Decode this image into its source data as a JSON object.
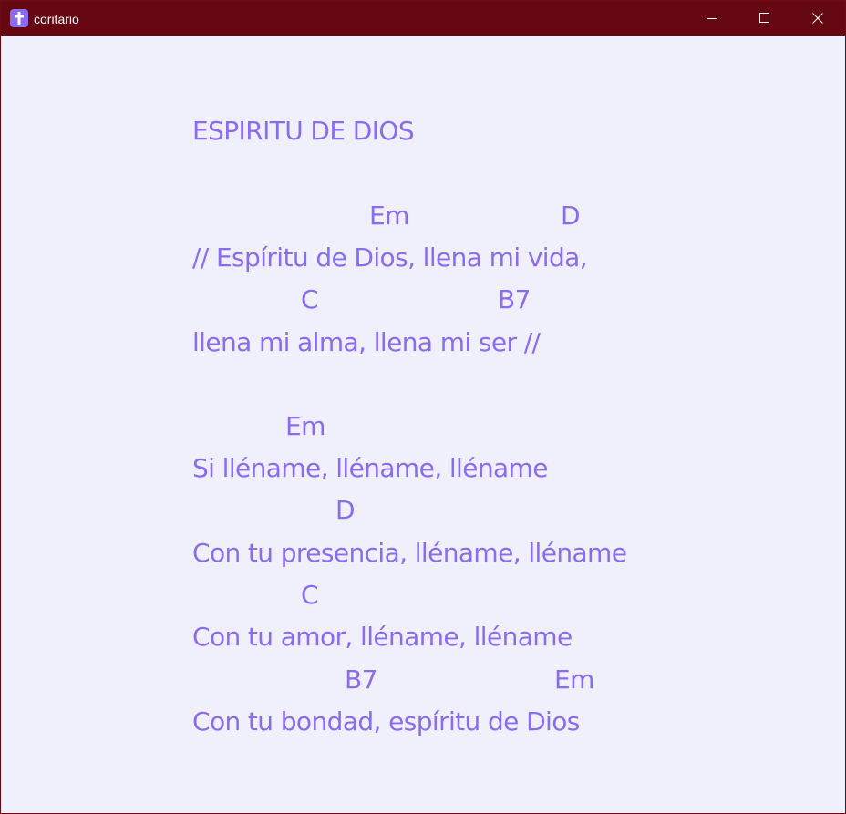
{
  "window": {
    "title": "coritario",
    "icon": "cross-icon",
    "controls": [
      "minimize-icon",
      "maximize-icon",
      "close-icon"
    ],
    "titlebar_color": "#660812"
  },
  "song": {
    "text_color": "#8a6cf0",
    "title": "ESPIRITU DE DIOS",
    "lines": [
      {
        "type": "chord",
        "text": "Em"
      },
      {
        "type": "chord",
        "text": "D"
      },
      {
        "type": "lyric",
        "text": "// Espíritu de Dios, llena mi vida,"
      },
      {
        "type": "chord",
        "text": "C"
      },
      {
        "type": "chord",
        "text": "B7"
      },
      {
        "type": "lyric",
        "text": "llena mi alma, llena mi ser //"
      },
      {
        "type": "chord",
        "text": "Em"
      },
      {
        "type": "lyric",
        "text": "Si lléname, lléname, lléname"
      },
      {
        "type": "chord",
        "text": "D"
      },
      {
        "type": "lyric",
        "text": "Con tu presencia, lléname, lléname"
      },
      {
        "type": "chord",
        "text": "C"
      },
      {
        "type": "lyric",
        "text": "Con tu amor, lléname, lléname"
      },
      {
        "type": "chord",
        "text": "B7"
      },
      {
        "type": "chord",
        "text": "Em"
      },
      {
        "type": "lyric",
        "text": "Con tu bondad, espíritu de Dios"
      }
    ]
  }
}
